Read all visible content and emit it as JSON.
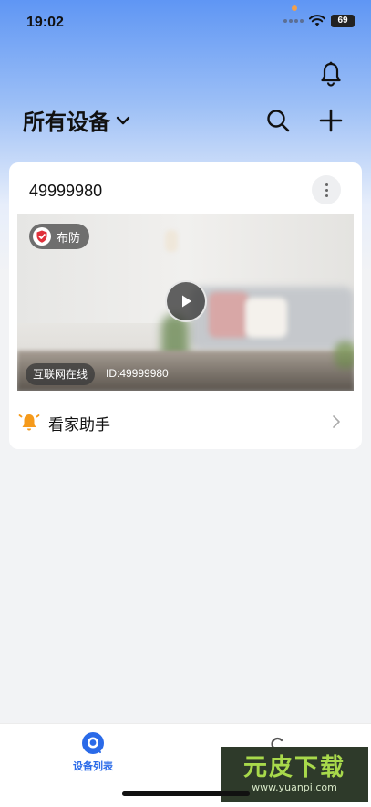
{
  "status_bar": {
    "time": "19:02",
    "battery": "69"
  },
  "header": {
    "title": "所有设备"
  },
  "device_card": {
    "name": "49999980",
    "armed_status": "布防",
    "online_status": "互联网在线",
    "device_id": "ID:49999980",
    "assistant_label": "看家助手"
  },
  "tabbar": {
    "devices_label": "设备列表"
  },
  "watermark": {
    "brand": "元皮下载",
    "url": "www.yuanpi.com"
  },
  "colors": {
    "accent": "#2a6ae8",
    "alarm": "#e0303a",
    "bell_orange": "#f59a1b"
  }
}
